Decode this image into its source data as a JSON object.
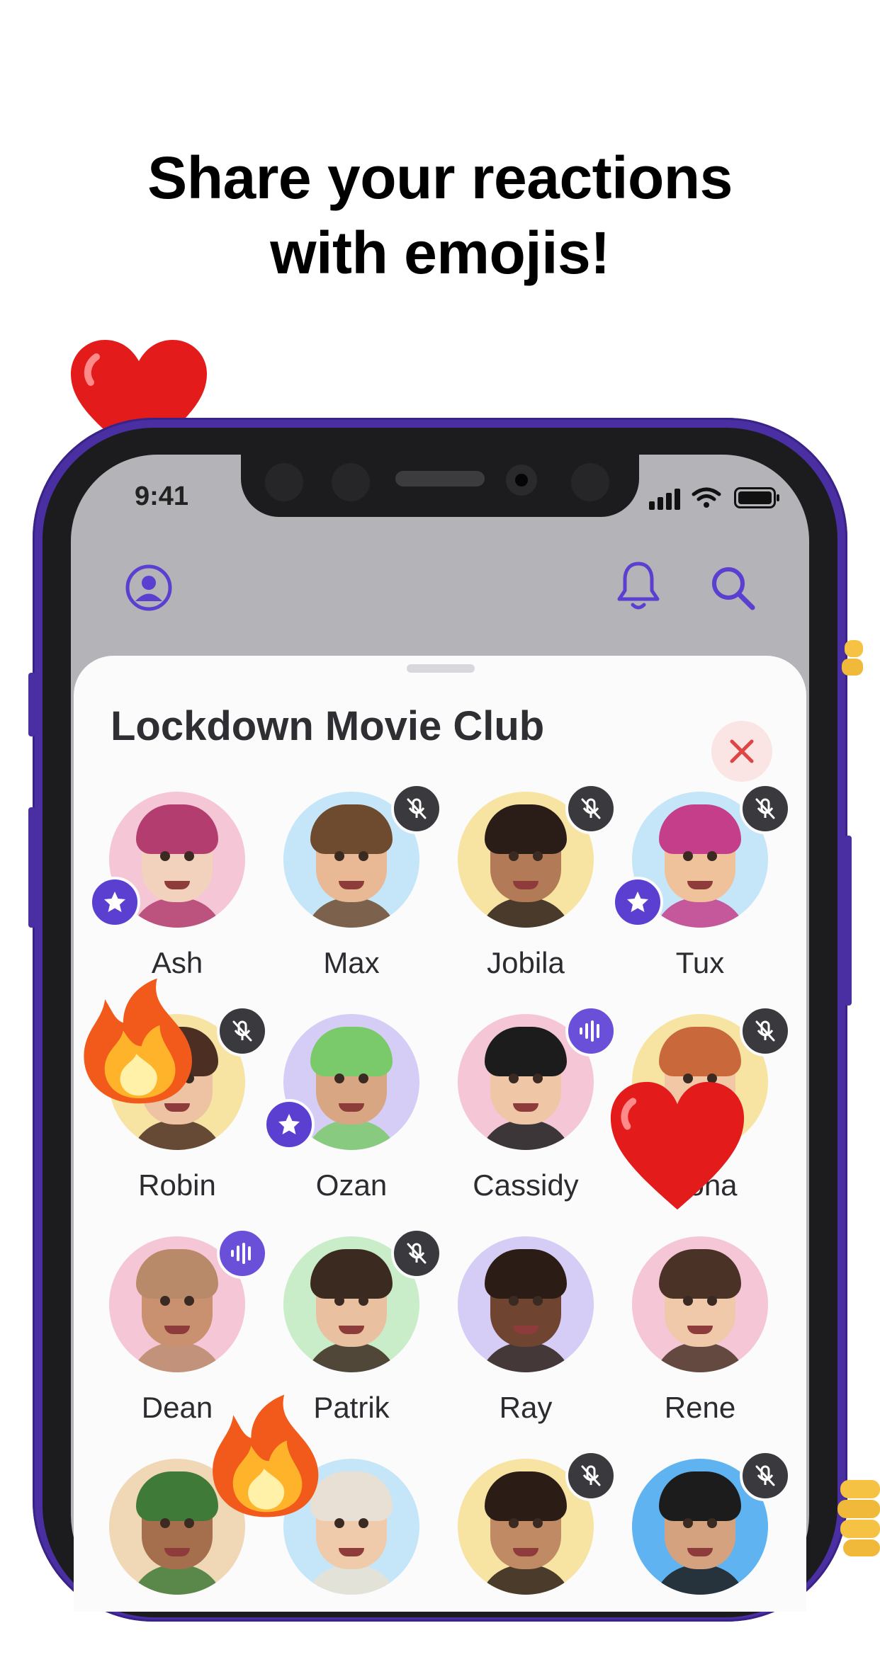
{
  "headline": {
    "line1": "Share your reactions",
    "line2": "with emojis!"
  },
  "status_bar": {
    "time": "9:41"
  },
  "top_bar": {
    "profile_icon": "user-circle-icon",
    "notification_icon": "bell-icon",
    "search_icon": "search-icon"
  },
  "room": {
    "title": "Lockdown Movie Club",
    "close_icon": "close-icon"
  },
  "colors": {
    "accent": "#5b3fd0",
    "close_red": "#e04545",
    "close_bg": "#fbe4e4",
    "sheet_bg": "#fbfbfc",
    "phone_frame": "#4a2fa3"
  },
  "participants": [
    {
      "name": "Ash",
      "bg": "#f5c6d6",
      "skin": "#f3d2bd",
      "hair": "#b23d6e",
      "status": "none",
      "host": true
    },
    {
      "name": "Max",
      "bg": "#c5e6f8",
      "skin": "#e9b894",
      "hair": "#6e4a2e",
      "status": "muted",
      "host": false
    },
    {
      "name": "Jobila",
      "bg": "#f7e4a2",
      "skin": "#b27a56",
      "hair": "#2a1c16",
      "status": "muted",
      "host": false
    },
    {
      "name": "Tux",
      "bg": "#c5e6f8",
      "skin": "#efc29c",
      "hair": "#c43e8a",
      "status": "muted",
      "host": true
    },
    {
      "name": "Robin",
      "bg": "#f7e4a2",
      "skin": "#eec3a3",
      "hair": "#4c2f22",
      "status": "muted",
      "host": false
    },
    {
      "name": "Ozan",
      "bg": "#d5cdf5",
      "skin": "#d9a684",
      "hair": "#7ac96a",
      "status": "none",
      "host": true
    },
    {
      "name": "Cassidy",
      "bg": "#f5c6d6",
      "skin": "#efc6a6",
      "hair": "#1c1c1c",
      "status": "talking",
      "host": false
    },
    {
      "name": "...ona",
      "bg": "#f7e4a2",
      "skin": "#f1c7a6",
      "hair": "#c9683a",
      "status": "muted",
      "host": false
    },
    {
      "name": "Dean",
      "bg": "#f5c6d6",
      "skin": "#c99170",
      "hair": "#b98a6a",
      "status": "talking",
      "host": false
    },
    {
      "name": "Patrik",
      "bg": "#c9ecc9",
      "skin": "#e9c1a0",
      "hair": "#3b2a20",
      "status": "muted",
      "host": false
    },
    {
      "name": "Ray",
      "bg": "#d5cdf5",
      "skin": "#6f4430",
      "hair": "#2b1d16",
      "status": "none",
      "host": false
    },
    {
      "name": "Rene",
      "bg": "#f5c6d6",
      "skin": "#f0c8aa",
      "hair": "#4a3226",
      "status": "none",
      "host": false
    },
    {
      "name": "",
      "bg": "#f0d7b6",
      "skin": "#a56e4c",
      "hair": "#3f7a38",
      "status": "none",
      "host": false
    },
    {
      "name": "",
      "bg": "#c5e6f8",
      "skin": "#efcbab",
      "hair": "#e8e0d4",
      "status": "none",
      "host": false
    },
    {
      "name": "",
      "bg": "#f7e4a2",
      "skin": "#c08a64",
      "hair": "#2b1d16",
      "status": "muted",
      "host": false
    },
    {
      "name": "",
      "bg": "#5fb3f0",
      "skin": "#d4a27e",
      "hair": "#1c1c1c",
      "status": "muted",
      "host": false
    }
  ],
  "reactions": [
    "heart-emoji",
    "fire-emoji",
    "heart-emoji",
    "fire-emoji",
    "thumbs-up-emoji"
  ]
}
